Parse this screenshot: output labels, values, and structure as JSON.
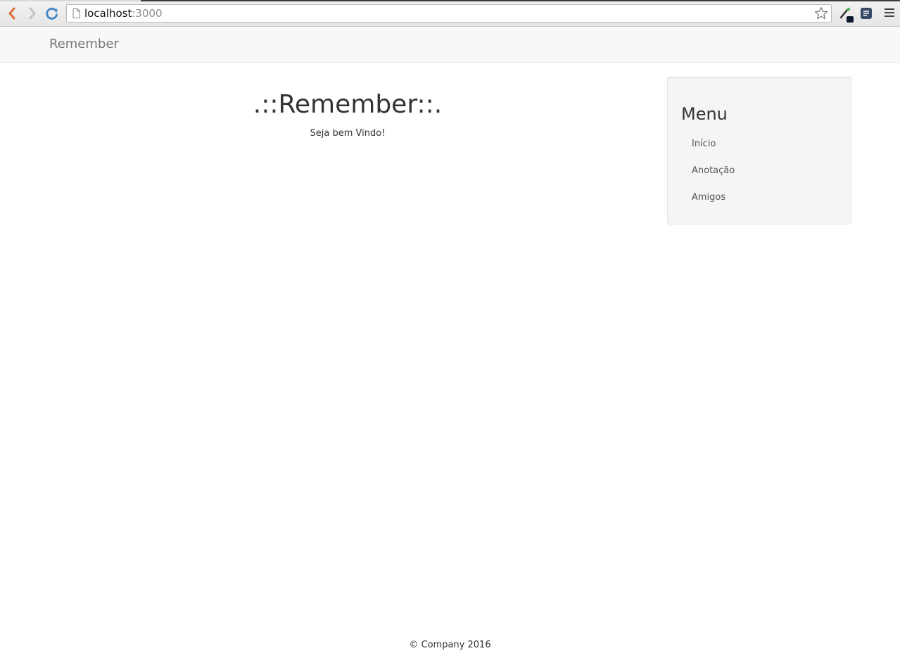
{
  "browser": {
    "url_host": "localhost",
    "url_port": ":3000"
  },
  "navbar": {
    "brand": "Remember"
  },
  "main": {
    "title": ".::Remember::.",
    "welcome": "Seja bem Vindo!"
  },
  "sidebar": {
    "heading": "Menu",
    "items": [
      {
        "label": "Início"
      },
      {
        "label": "Anotação"
      },
      {
        "label": "Amigos"
      }
    ]
  },
  "footer": {
    "text": "© Company 2016"
  },
  "colors": {
    "navbar_bg": "#f8f8f8",
    "sidebar_bg": "#f5f5f5",
    "brand_text": "#777777",
    "link_text": "#555555"
  },
  "icons": {
    "back": "back-arrow-icon",
    "forward": "forward-arrow-icon",
    "reload": "reload-icon",
    "page": "page-icon",
    "bookmark": "star-icon",
    "extension_1": "eyedropper-icon",
    "extension_2": "extension-icon",
    "menu": "hamburger-menu-icon"
  }
}
